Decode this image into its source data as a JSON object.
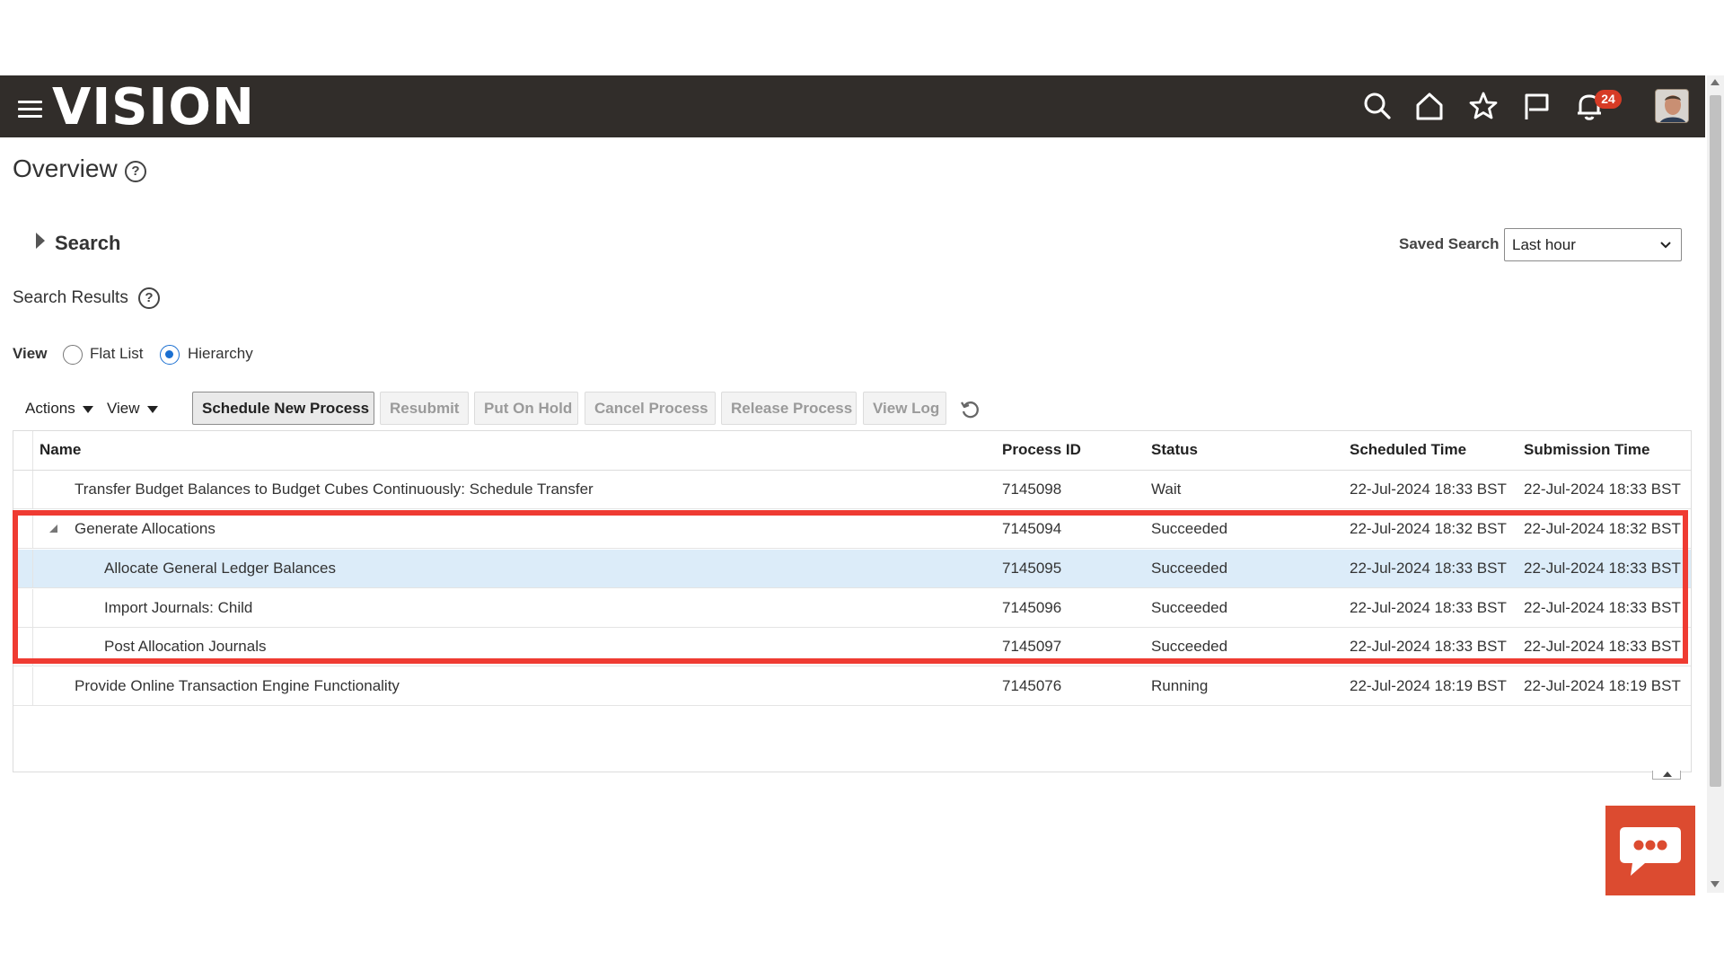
{
  "header": {
    "logo": "VISION",
    "notification_count": "24",
    "icons": [
      "search-icon",
      "home-icon",
      "star-icon",
      "flag-icon",
      "bell-icon"
    ]
  },
  "page": {
    "title": "Overview"
  },
  "search": {
    "label": "Search",
    "saved_search_label": "Saved Search",
    "saved_search_value": "Last hour"
  },
  "results": {
    "label": "Search Results"
  },
  "view": {
    "label": "View",
    "options": [
      "Flat List",
      "Hierarchy"
    ],
    "selected": "Hierarchy"
  },
  "toolbar": {
    "actions_label": "Actions",
    "view_label": "View",
    "buttons": [
      "Schedule New Process",
      "Resubmit",
      "Put On Hold",
      "Cancel Process",
      "Release Process",
      "View Log"
    ]
  },
  "table": {
    "columns": [
      "Name",
      "Process ID",
      "Status",
      "Scheduled Time",
      "Submission Time"
    ],
    "rows": [
      {
        "name": "Transfer Budget Balances to Budget Cubes Continuously: Schedule Transfer",
        "process_id": "7145098",
        "status": "Wait",
        "scheduled": "22-Jul-2024 18:33 BST",
        "submitted": "22-Jul-2024 18:33 BST"
      },
      {
        "name": "Generate Allocations",
        "process_id": "7145094",
        "status": "Succeeded",
        "scheduled": "22-Jul-2024 18:32 BST",
        "submitted": "22-Jul-2024 18:32 BST"
      },
      {
        "name": "Allocate General Ledger Balances",
        "process_id": "7145095",
        "status": "Succeeded",
        "scheduled": "22-Jul-2024 18:33 BST",
        "submitted": "22-Jul-2024 18:33 BST"
      },
      {
        "name": "Import Journals: Child",
        "process_id": "7145096",
        "status": "Succeeded",
        "scheduled": "22-Jul-2024 18:33 BST",
        "submitted": "22-Jul-2024 18:33 BST"
      },
      {
        "name": "Post Allocation Journals",
        "process_id": "7145097",
        "status": "Succeeded",
        "scheduled": "22-Jul-2024 18:33 BST",
        "submitted": "22-Jul-2024 18:33 BST"
      },
      {
        "name": "Provide Online Transaction Engine Functionality",
        "process_id": "7145076",
        "status": "Running",
        "scheduled": "22-Jul-2024 18:19 BST",
        "submitted": "22-Jul-2024 18:19 BST"
      }
    ]
  },
  "colors": {
    "header_bg": "#312d2a",
    "highlight_border": "#ef3b32",
    "selected_row": "#dcecf9",
    "chat_button": "#dc4b30",
    "badge": "#d63b25"
  }
}
